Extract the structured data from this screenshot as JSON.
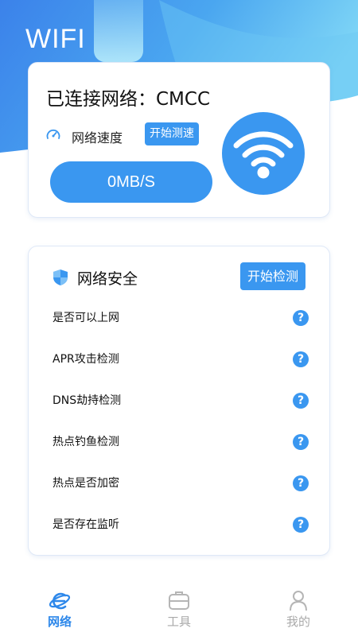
{
  "app": {
    "title": "WIFI"
  },
  "connection": {
    "title": "已连接网络：CMCC",
    "speed_label": "网络速度",
    "speed_test_button": "开始测速",
    "speed_value": "0MB/S"
  },
  "security": {
    "title": "网络安全",
    "start_button": "开始检测",
    "items": [
      {
        "label": "是否可以上网",
        "help": "?"
      },
      {
        "label": "APR攻击检测",
        "help": "?"
      },
      {
        "label": "DNS劫持检测",
        "help": "?"
      },
      {
        "label": "热点钓鱼检测",
        "help": "?"
      },
      {
        "label": "热点是否加密",
        "help": "?"
      },
      {
        "label": "是否存在监听",
        "help": "?"
      }
    ]
  },
  "tabbar": {
    "tabs": [
      {
        "label": "网络",
        "active": true
      },
      {
        "label": "工具",
        "active": false
      },
      {
        "label": "我的",
        "active": false
      }
    ]
  },
  "colors": {
    "primary": "#3a97f0",
    "hero_top": "#3d8fec",
    "hero_light": "#7fd3f5",
    "tab_active": "#2e88ea",
    "tab_inactive": "#aaaaaa"
  }
}
